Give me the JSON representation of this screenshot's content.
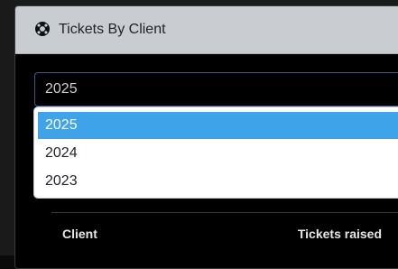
{
  "card": {
    "title": "Tickets By Client",
    "icon": "life-ring-icon"
  },
  "year_select": {
    "value": "2025",
    "options": [
      "2025",
      "2024",
      "2023"
    ],
    "highlighted": "2025"
  },
  "table": {
    "columns": [
      "Client",
      "Tickets raised"
    ]
  },
  "colors": {
    "header_bg": "#c9cdd1",
    "highlight": "#3ea3e8",
    "select_border": "#3b5b8c"
  }
}
